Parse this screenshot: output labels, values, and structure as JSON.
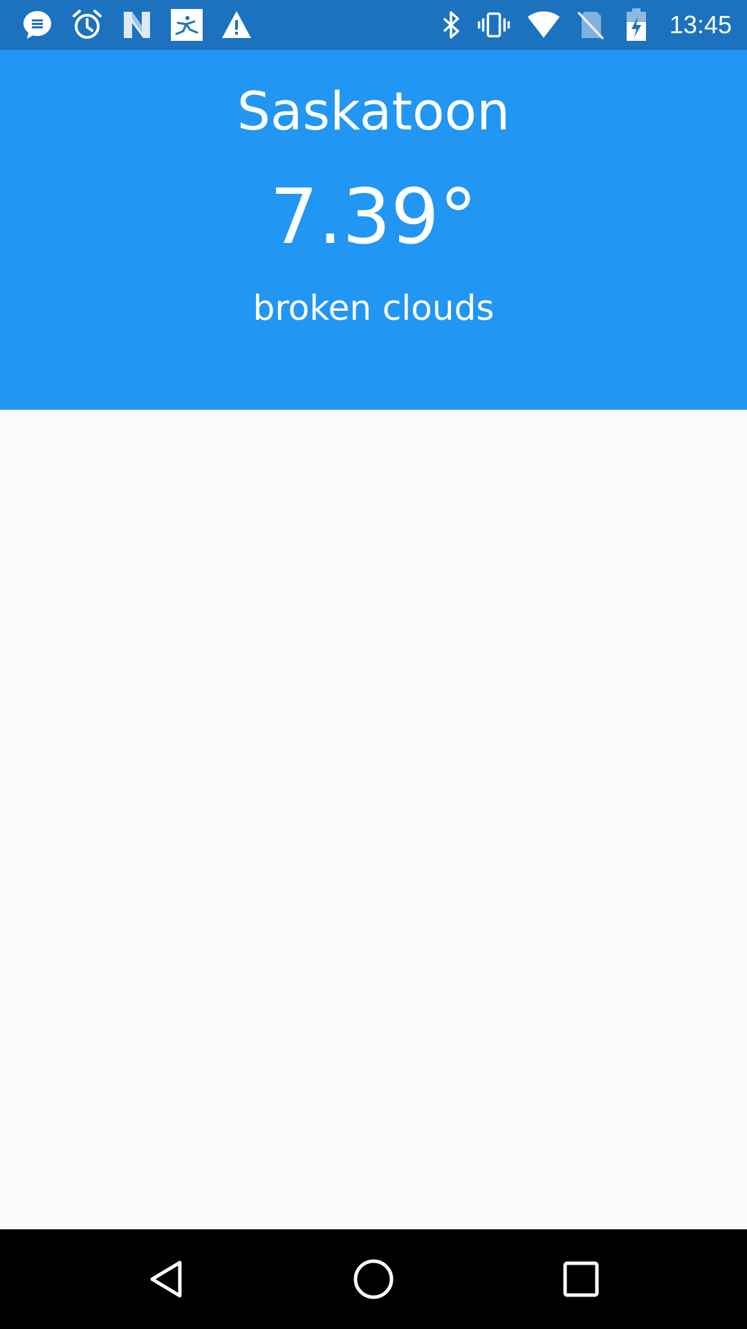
{
  "status_bar": {
    "time": "13:45",
    "background": "#1c72bf",
    "left_icons": [
      "messages-icon",
      "alarm-clock-icon",
      "app-n-icon",
      "fitness-app-icon",
      "warning-icon"
    ],
    "right_icons": [
      "bluetooth-icon",
      "vibrate-icon",
      "wifi-icon",
      "no-sim-icon",
      "battery-charging-icon"
    ]
  },
  "weather": {
    "city": "Saskatoon",
    "temperature": "7.39°",
    "description": "broken clouds",
    "header_color": "#2196f3"
  },
  "nav_bar": {
    "buttons": [
      "back-icon",
      "home-icon",
      "recents-icon"
    ]
  }
}
